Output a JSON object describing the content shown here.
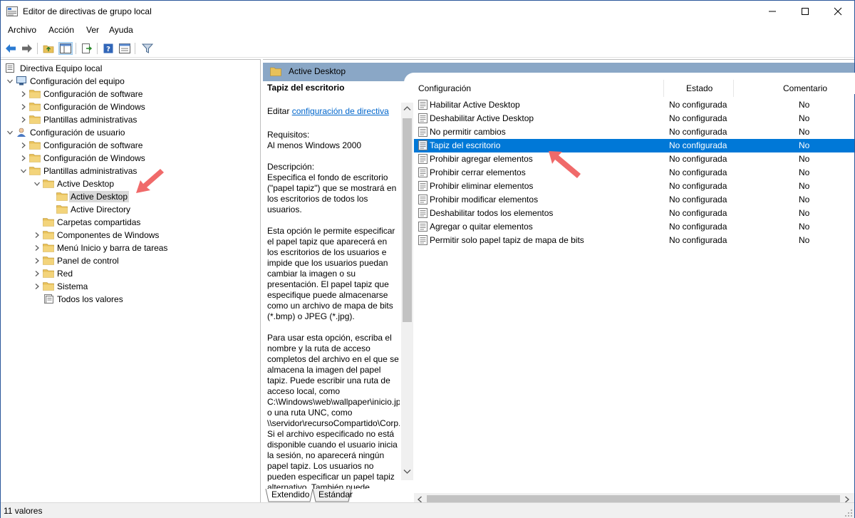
{
  "window": {
    "title": "Editor de directivas de grupo local"
  },
  "menu": [
    "Archivo",
    "Acción",
    "Ver",
    "Ayuda"
  ],
  "toolbar": {
    "icons": [
      "back-icon",
      "forward-icon",
      "up-folder-icon",
      "show-hide-tree-icon",
      "export-list-icon",
      "help-icon",
      "properties-icon",
      "filter-icon"
    ]
  },
  "tree": {
    "root": "Directiva Equipo local",
    "items": [
      {
        "label": "Configuración del equipo",
        "level": 1,
        "expanded": true,
        "icon": "computer-icon"
      },
      {
        "label": "Configuración de software",
        "level": 2,
        "expanded": false,
        "icon": "folder-icon"
      },
      {
        "label": "Configuración de Windows",
        "level": 2,
        "expanded": false,
        "icon": "folder-icon"
      },
      {
        "label": "Plantillas administrativas",
        "level": 2,
        "expanded": false,
        "icon": "folder-icon"
      },
      {
        "label": "Configuración de usuario",
        "level": 1,
        "expanded": true,
        "icon": "user-icon"
      },
      {
        "label": "Configuración de software",
        "level": 2,
        "expanded": false,
        "icon": "folder-icon"
      },
      {
        "label": "Configuración de Windows",
        "level": 2,
        "expanded": false,
        "icon": "folder-icon"
      },
      {
        "label": "Plantillas administrativas",
        "level": 2,
        "expanded": true,
        "icon": "folder-icon"
      },
      {
        "label": "Active Desktop",
        "level": 3,
        "expanded": true,
        "icon": "folder-icon"
      },
      {
        "label": "Active Desktop",
        "level": 4,
        "selected": true,
        "icon": "folder-icon"
      },
      {
        "label": "Active Directory",
        "level": 4,
        "icon": "folder-icon"
      },
      {
        "label": "Carpetas compartidas",
        "level": 3,
        "icon": "folder-icon"
      },
      {
        "label": "Componentes de Windows",
        "level": 3,
        "expanded": false,
        "icon": "folder-icon"
      },
      {
        "label": "Menú Inicio y barra de tareas",
        "level": 3,
        "expanded": false,
        "icon": "folder-icon"
      },
      {
        "label": "Panel de control",
        "level": 3,
        "expanded": false,
        "icon": "folder-icon"
      },
      {
        "label": "Red",
        "level": 3,
        "expanded": false,
        "icon": "folder-icon"
      },
      {
        "label": "Sistema",
        "level": 3,
        "expanded": false,
        "icon": "folder-icon"
      },
      {
        "label": "Todos los valores",
        "level": 3,
        "icon": "all-settings-icon"
      }
    ]
  },
  "header": {
    "title": "Active Desktop"
  },
  "description": {
    "title": "Tapiz del escritorio",
    "edit_prefix": "Editar ",
    "edit_link": "configuración de directiva",
    "requirements_label": "Requisitos:",
    "requirements_value": "Al menos Windows 2000",
    "description_label": "Descripción:",
    "description_text": "Especifica el fondo de escritorio (\"papel tapiz\") que se mostrará en los escritorios de todos los usuarios.",
    "paragraph2": "Esta opción le permite especificar el papel tapiz que aparecerá en los escritorios de los usuarios e impide que los usuarios puedan cambiar la imagen o su presentación. El papel tapiz que especifique puede almacenarse como un archivo de mapa de bits (*.bmp) o JPEG (*.jpg).",
    "paragraph3": "Para usar esta opción, escriba el nombre y la ruta de acceso completos del archivo en el que se almacena la imagen del papel tapiz. Puede escribir una ruta de acceso local, como C:\\Windows\\web\\wallpaper\\inicio.jpg o una ruta UNC, como \\\\servidor\\recursoCompartido\\Corp.jpg. Si el archivo especificado no está disponible cuando el usuario inicia la sesión, no aparecerá ningún papel tapiz. Los usuarios no pueden especificar un papel tapiz alternativo. También puede"
  },
  "tabs": [
    "Extendido",
    "Estándar"
  ],
  "columns": {
    "config": "Configuración",
    "state": "Estado",
    "comment": "Comentario"
  },
  "rows": [
    {
      "name": "Habilitar Active Desktop",
      "state": "No configurada",
      "comment": "No"
    },
    {
      "name": "Deshabilitar Active Desktop",
      "state": "No configurada",
      "comment": "No"
    },
    {
      "name": "No permitir cambios",
      "state": "No configurada",
      "comment": "No"
    },
    {
      "name": "Tapiz del escritorio",
      "state": "No configurada",
      "comment": "No",
      "selected": true
    },
    {
      "name": "Prohibir agregar elementos",
      "state": "No configurada",
      "comment": "No"
    },
    {
      "name": "Prohibir cerrar elementos",
      "state": "No configurada",
      "comment": "No"
    },
    {
      "name": "Prohibir eliminar elementos",
      "state": "No configurada",
      "comment": "No"
    },
    {
      "name": "Prohibir modificar elementos",
      "state": "No configurada",
      "comment": "No"
    },
    {
      "name": "Deshabilitar todos los elementos",
      "state": "No configurada",
      "comment": "No"
    },
    {
      "name": "Agregar o quitar elementos",
      "state": "No configurada",
      "comment": "No"
    },
    {
      "name": "Permitir solo papel tapiz de mapa de bits",
      "state": "No configurada",
      "comment": "No"
    }
  ],
  "status": {
    "count": "11 valores"
  },
  "colors": {
    "selection": "#0078d7",
    "header_band": "#8aa7c6",
    "annotation_arrow": "#f06a6a",
    "folder": "#e8c15a"
  }
}
